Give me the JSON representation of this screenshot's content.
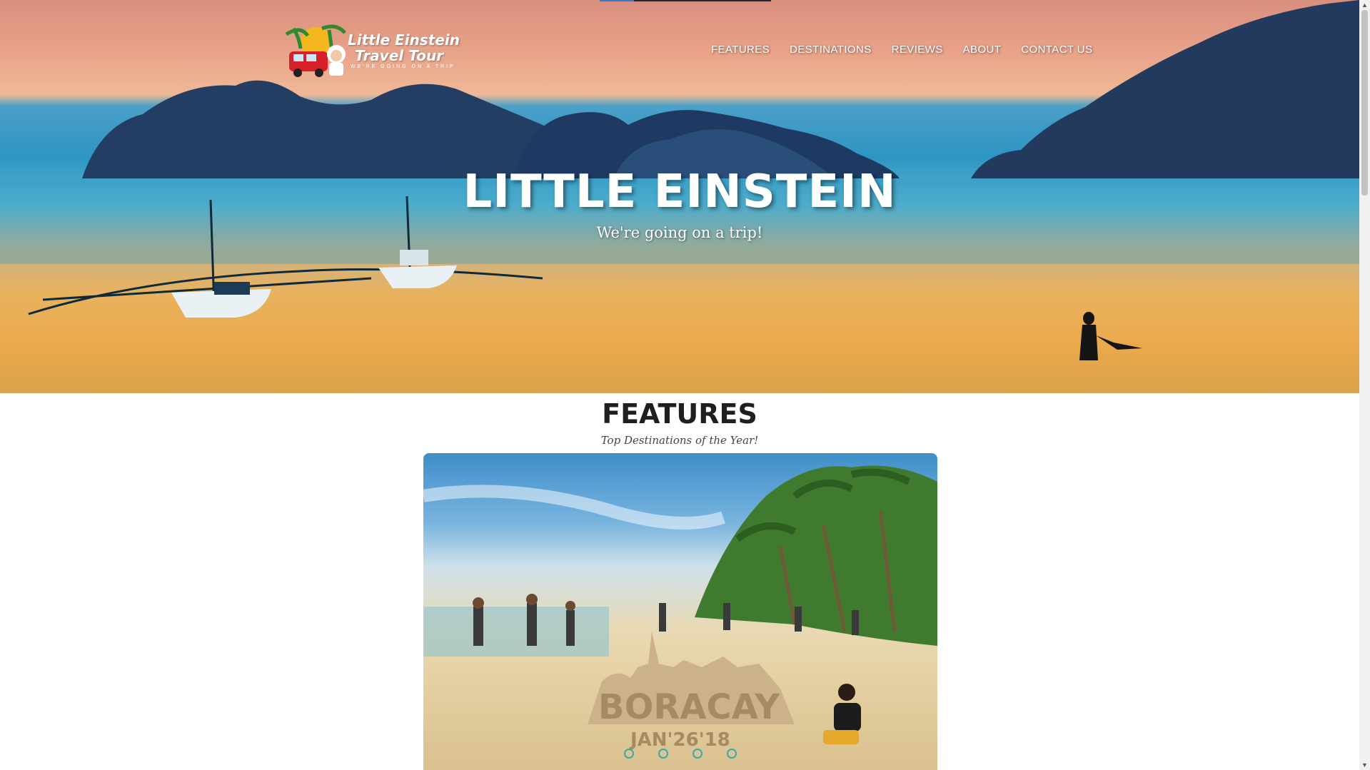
{
  "brand": {
    "name_line1": "Little Einstein",
    "name_line2": "Travel Tour",
    "tagline": "WE'RE GOING ON A TRIP"
  },
  "nav": {
    "items": [
      {
        "label": "FEATURES"
      },
      {
        "label": "DESTINATIONS"
      },
      {
        "label": "REVIEWS"
      },
      {
        "label": "ABOUT"
      },
      {
        "label": "CONTACT US"
      }
    ]
  },
  "hero": {
    "title": "LITTLE EINSTEIN",
    "subtitle": "We're going on a trip!"
  },
  "features": {
    "title": "FEATURES",
    "subtitle": "Top Destinations of the Year!",
    "slide": {
      "sand_text_main": "BORACAY",
      "sand_text_date": "JAN'26'18",
      "dot_count": 4
    }
  },
  "colors": {
    "nav_text": "#ffffff",
    "heading": "#1f1f1f",
    "dot_accent": "#3fa6b2"
  }
}
